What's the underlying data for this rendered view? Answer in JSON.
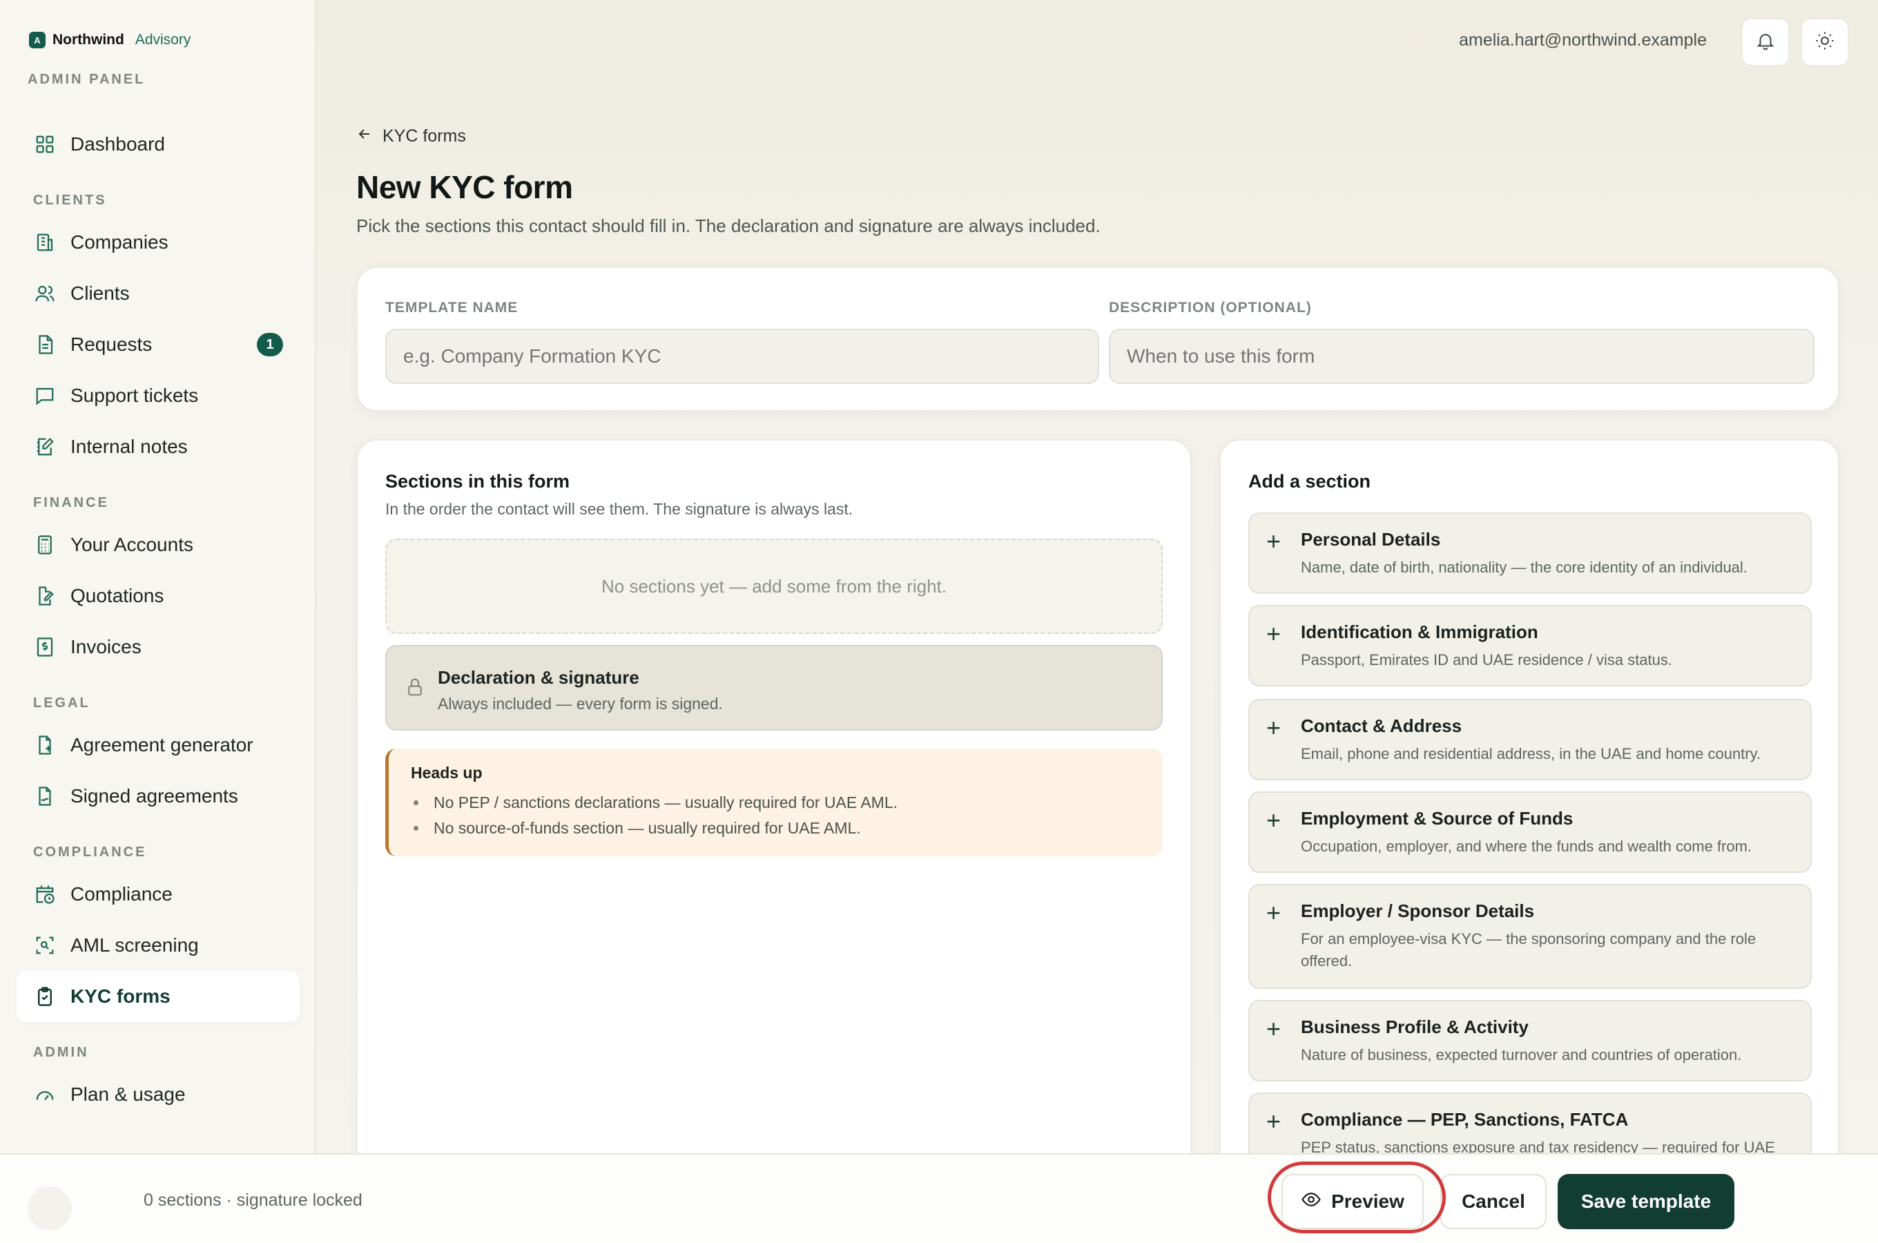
{
  "brand": {
    "mark": "A",
    "name": "Northwind",
    "sub": "Advisory"
  },
  "admin_panel_label": "ADMIN PANEL",
  "sidebar": {
    "dashboard": "Dashboard",
    "sections": {
      "clients": "CLIENTS",
      "finance": "FINANCE",
      "legal": "LEGAL",
      "compliance": "COMPLIANCE",
      "admin": "ADMIN"
    },
    "items": {
      "companies": "Companies",
      "clients": "Clients",
      "requests": "Requests",
      "requests_badge": "1",
      "support": "Support tickets",
      "notes": "Internal notes",
      "accounts": "Your Accounts",
      "quotations": "Quotations",
      "invoices": "Invoices",
      "agreement_gen": "Agreement generator",
      "signed": "Signed agreements",
      "compliance": "Compliance",
      "aml": "AML screening",
      "kyc": "KYC forms",
      "plan": "Plan & usage"
    }
  },
  "topbar": {
    "email": "amelia.hart@northwind.example",
    "bell_icon": "bell-icon",
    "theme_icon": "sun-icon"
  },
  "page": {
    "back": "KYC forms",
    "title": "New KYC form",
    "subtitle": "Pick the sections this contact should fill in. The declaration and signature are always included."
  },
  "template_form": {
    "name_label": "TEMPLATE NAME",
    "name_placeholder": "e.g. Company Formation KYC",
    "desc_label": "DESCRIPTION (OPTIONAL)",
    "desc_placeholder": "When to use this form"
  },
  "sections_card": {
    "title": "Sections in this form",
    "desc": "In the order the contact will see them. The signature is always last.",
    "empty": "No sections yet — add some from the right.",
    "declaration_title": "Declaration & signature",
    "declaration_sub": "Always included — every form is signed.",
    "heads_up_title": "Heads up",
    "heads_up_items": [
      "No PEP / sanctions declarations — usually required for UAE AML.",
      "No source-of-funds section — usually required for UAE AML."
    ]
  },
  "add_card": {
    "title": "Add a section",
    "items": [
      {
        "title": "Personal Details",
        "desc": "Name, date of birth, nationality — the core identity of an individual."
      },
      {
        "title": "Identification & Immigration",
        "desc": "Passport, Emirates ID and UAE residence / visa status."
      },
      {
        "title": "Contact & Address",
        "desc": "Email, phone and residential address, in the UAE and home country."
      },
      {
        "title": "Employment & Source of Funds",
        "desc": "Occupation, employer, and where the funds and wealth come from."
      },
      {
        "title": "Employer / Sponsor Details",
        "desc": "For an employee-visa KYC — the sponsoring company and the role offered."
      },
      {
        "title": "Business Profile & Activity",
        "desc": "Nature of business, expected turnover and countries of operation."
      },
      {
        "title": "Compliance — PEP, Sanctions, FATCA",
        "desc": "PEP status, sanctions exposure and tax residency — required for UAE"
      }
    ]
  },
  "bottombar": {
    "status": "0 sections · signature locked",
    "preview": "Preview",
    "cancel": "Cancel",
    "save": "Save template"
  },
  "colors": {
    "accent": "#123d33",
    "brand": "#145c4a",
    "highlight": "#d23a3a",
    "warning": "#b8782d"
  }
}
